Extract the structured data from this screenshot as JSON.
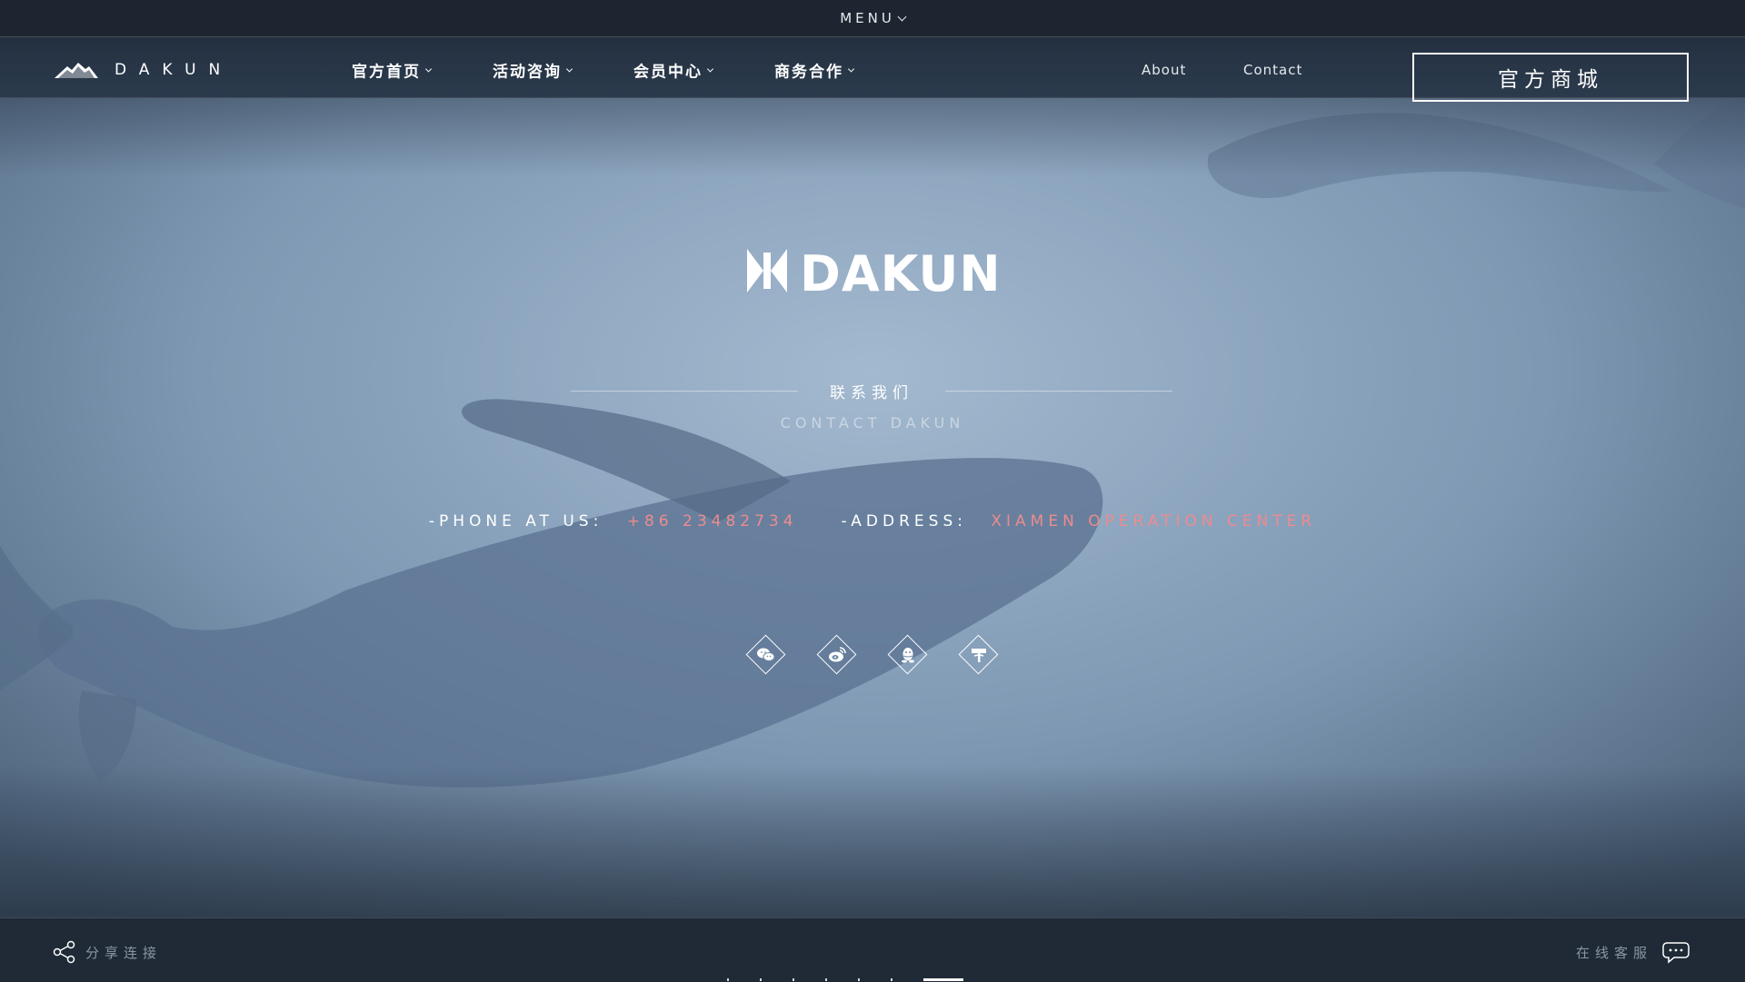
{
  "colors": {
    "accent": "#ee8b8f",
    "nav_bg": "#243040",
    "background": "#6f8ba6"
  },
  "topbar": {
    "menu_label": "MENU"
  },
  "nav": {
    "logo_text": "DAKUN",
    "items": [
      {
        "label": "官方首页"
      },
      {
        "label": "活动咨询"
      },
      {
        "label": "会员中心"
      },
      {
        "label": "商务合作"
      }
    ],
    "links": [
      {
        "label": "About"
      },
      {
        "label": "Contact"
      }
    ],
    "shop_button": "官方商城"
  },
  "main": {
    "brand": "DAKUN",
    "contact_title": "联系我们",
    "contact_subtitle": "CONTACT DAKUN",
    "phone_label": "-PHONE AT US:",
    "phone_value": "+86 23482734",
    "address_label": "-ADDRESS:",
    "address_value": "XIAMEN OPERATION CENTER",
    "social": [
      {
        "icon": "wechat-icon"
      },
      {
        "icon": "weibo-icon"
      },
      {
        "icon": "qq-icon"
      },
      {
        "icon": "tieba-icon"
      }
    ]
  },
  "footer": {
    "share_label": "分享连接",
    "service_label": "在线客服",
    "pagination": {
      "count": 8,
      "active": 7
    }
  }
}
